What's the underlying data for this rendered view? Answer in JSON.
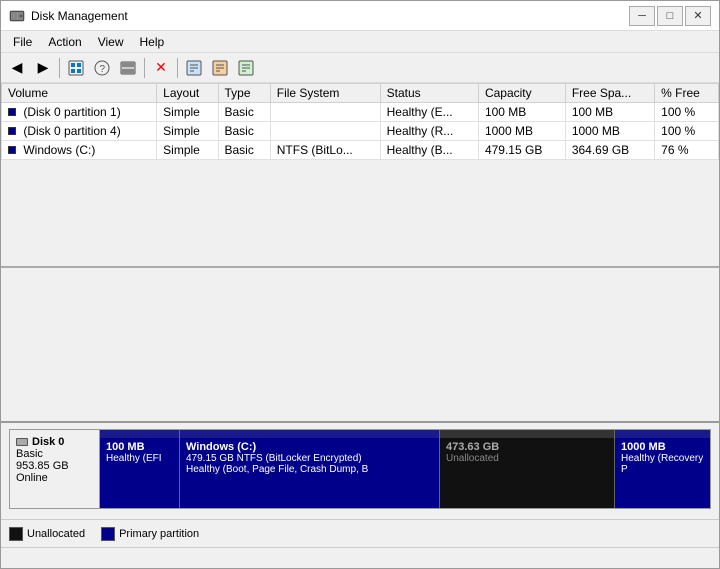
{
  "window": {
    "title": "Disk Management",
    "controls": {
      "minimize": "─",
      "maximize": "□",
      "close": "✕"
    }
  },
  "menu": {
    "items": [
      "File",
      "Action",
      "View",
      "Help"
    ]
  },
  "toolbar": {
    "buttons": [
      {
        "name": "back",
        "icon": "◀",
        "disabled": false
      },
      {
        "name": "forward",
        "icon": "▶",
        "disabled": false
      },
      {
        "name": "snap",
        "icon": "⊞",
        "disabled": false
      },
      {
        "name": "help",
        "icon": "?",
        "disabled": false
      },
      {
        "name": "disk-mgmt",
        "icon": "⊟",
        "disabled": false
      },
      {
        "name": "delete",
        "icon": "✕",
        "disabled": false,
        "color": "red"
      },
      {
        "name": "prop1",
        "icon": "⊡",
        "disabled": false
      },
      {
        "name": "prop2",
        "icon": "⊞",
        "disabled": false
      },
      {
        "name": "prop3",
        "icon": "⊟",
        "disabled": false
      }
    ]
  },
  "table": {
    "columns": [
      "Volume",
      "Layout",
      "Type",
      "File System",
      "Status",
      "Capacity",
      "Free Spa...",
      "% Free"
    ],
    "rows": [
      {
        "volume": "(Disk 0 partition 1)",
        "layout": "Simple",
        "type": "Basic",
        "filesystem": "",
        "status": "Healthy (E...",
        "capacity": "100 MB",
        "free_space": "100 MB",
        "pct_free": "100 %"
      },
      {
        "volume": "(Disk 0 partition 4)",
        "layout": "Simple",
        "type": "Basic",
        "filesystem": "",
        "status": "Healthy (R...",
        "capacity": "1000 MB",
        "free_space": "1000 MB",
        "pct_free": "100 %"
      },
      {
        "volume": "Windows (C:)",
        "layout": "Simple",
        "type": "Basic",
        "filesystem": "NTFS (BitLo...",
        "status": "Healthy (B...",
        "capacity": "479.15 GB",
        "free_space": "364.69 GB",
        "pct_free": "76 %"
      }
    ]
  },
  "disk_visual": {
    "disk_label": {
      "name": "Disk 0",
      "type": "Basic",
      "size": "953.85 GB",
      "status": "Online"
    },
    "partitions": [
      {
        "id": "efi",
        "size": "100 MB",
        "label": "Healthy (EFI",
        "type": "primary"
      },
      {
        "id": "windows-c",
        "name": "Windows (C:)",
        "size": "479.15 GB NTFS (BitLocker Encrypted)",
        "label": "Healthy (Boot, Page File, Crash Dump, B",
        "type": "primary"
      },
      {
        "id": "unallocated",
        "size": "473.63 GB",
        "label": "Unallocated",
        "type": "unallocated"
      },
      {
        "id": "recovery",
        "size": "1000 MB",
        "label": "Healthy (Recovery P",
        "type": "primary"
      }
    ]
  },
  "legend": {
    "items": [
      {
        "type": "unallocated",
        "label": "Unallocated"
      },
      {
        "type": "primary",
        "label": "Primary partition"
      }
    ]
  }
}
